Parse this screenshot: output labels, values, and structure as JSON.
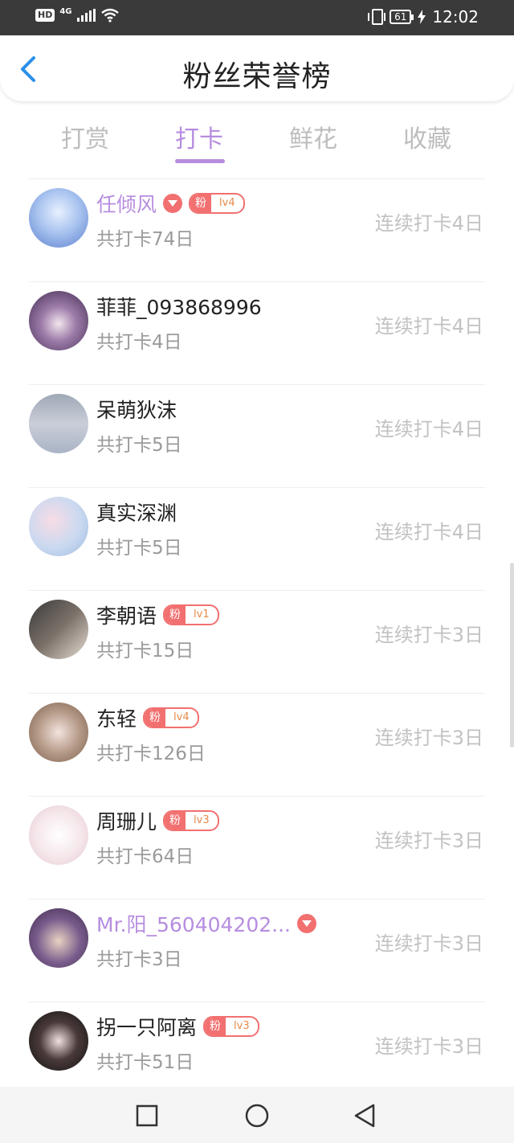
{
  "status_bar": {
    "hd": "HD",
    "network": "4G",
    "battery": "61",
    "time": "12:02"
  },
  "header": {
    "title": "粉丝荣誉榜"
  },
  "tabs": [
    {
      "label": "打赏"
    },
    {
      "label": "打卡"
    },
    {
      "label": "鲜花"
    },
    {
      "label": "收藏"
    }
  ],
  "active_tab": "打卡",
  "badge_prefix": "粉",
  "fans": [
    {
      "name": "任倾风",
      "total": "共打卡74日",
      "streak": "连续打卡4日",
      "level": "lv4",
      "vip": true
    },
    {
      "name": "菲菲_093868996",
      "total": "共打卡4日",
      "streak": "连续打卡4日",
      "level": "",
      "vip": false
    },
    {
      "name": "呆萌狄沫",
      "total": "共打卡5日",
      "streak": "连续打卡4日",
      "level": "",
      "vip": false
    },
    {
      "name": "真实深渊",
      "total": "共打卡5日",
      "streak": "连续打卡4日",
      "level": "",
      "vip": false
    },
    {
      "name": "李朝语",
      "total": "共打卡15日",
      "streak": "连续打卡3日",
      "level": "lv1",
      "vip": false
    },
    {
      "name": "东轻",
      "total": "共打卡126日",
      "streak": "连续打卡3日",
      "level": "lv4",
      "vip": false
    },
    {
      "name": "周珊儿",
      "total": "共打卡64日",
      "streak": "连续打卡3日",
      "level": "lv3",
      "vip": false
    },
    {
      "name": "Mr.阳_560404202...",
      "total": "共打卡3日",
      "streak": "连续打卡3日",
      "level": "",
      "vip": true
    },
    {
      "name": "拐一只阿离",
      "total": "共打卡51日",
      "streak": "连续打卡3日",
      "level": "lv3",
      "vip": false
    }
  ],
  "colors": {
    "accent": "#b78de0",
    "badge": "#f27070",
    "back_arrow": "#2b8fe8"
  }
}
